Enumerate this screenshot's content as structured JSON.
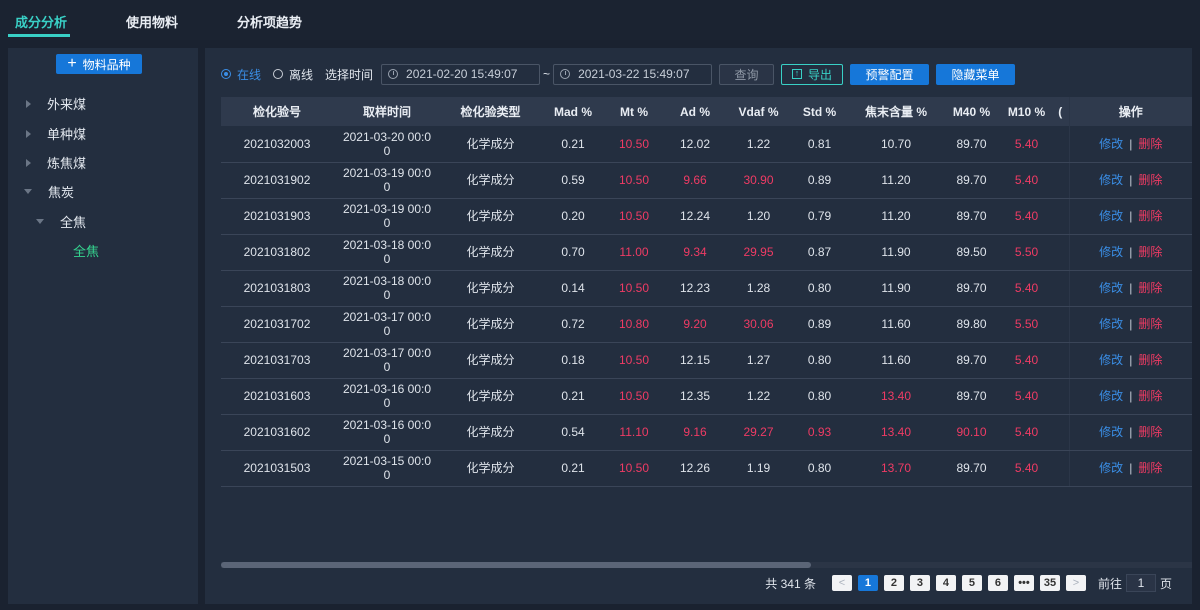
{
  "tabs": [
    {
      "label": "成分分析",
      "active": true
    },
    {
      "label": "使用物料",
      "active": false
    },
    {
      "label": "分析项趋势",
      "active": false
    }
  ],
  "sidebar": {
    "add_button": "物料品种",
    "tree": [
      {
        "label": "外来煤",
        "expanded": false
      },
      {
        "label": "单种煤",
        "expanded": false
      },
      {
        "label": "炼焦煤",
        "expanded": false
      },
      {
        "label": "焦炭",
        "expanded": true
      },
      {
        "label": "全焦",
        "expanded": true
      },
      {
        "label": "全焦",
        "selected": true
      }
    ]
  },
  "filters": {
    "online": "在线",
    "offline": "离线",
    "time_label": "选择时间",
    "start": "2021-02-20 15:49:07",
    "tilde": "~",
    "end": "2021-03-22 15:49:07",
    "query": "查询",
    "export": "导出",
    "warning_config": "预警配置",
    "hide_menu": "隐藏菜单"
  },
  "table": {
    "headers": [
      "检化验号",
      "取样时间",
      "检化验类型",
      "Mad %",
      "Mt %",
      "Ad %",
      "Vdaf %",
      "Std %",
      "焦末含量 %",
      "M40 %",
      "M10 %",
      "(",
      "操作"
    ],
    "edit": "修改",
    "sep": "|",
    "delete": "删除",
    "rows": [
      {
        "id": "2021032003",
        "time1": "2021-03-20 00:0",
        "time2": "0",
        "type": "化学成分",
        "mad": "0.21",
        "mt": "10.50",
        "ad": "12.02",
        "vdaf": "1.22",
        "std": "0.81",
        "jm": "10.70",
        "m40": "89.70",
        "m10": "5.40",
        "red": [
          "mt",
          "m10"
        ]
      },
      {
        "id": "2021031902",
        "time1": "2021-03-19 00:0",
        "time2": "0",
        "type": "化学成分",
        "mad": "0.59",
        "mt": "10.50",
        "ad": "9.66",
        "vdaf": "30.90",
        "std": "0.89",
        "jm": "11.20",
        "m40": "89.70",
        "m10": "5.40",
        "red": [
          "mt",
          "ad",
          "vdaf",
          "m10"
        ]
      },
      {
        "id": "2021031903",
        "time1": "2021-03-19 00:0",
        "time2": "0",
        "type": "化学成分",
        "mad": "0.20",
        "mt": "10.50",
        "ad": "12.24",
        "vdaf": "1.20",
        "std": "0.79",
        "jm": "11.20",
        "m40": "89.70",
        "m10": "5.40",
        "red": [
          "mt",
          "m10"
        ]
      },
      {
        "id": "2021031802",
        "time1": "2021-03-18 00:0",
        "time2": "0",
        "type": "化学成分",
        "mad": "0.70",
        "mt": "11.00",
        "ad": "9.34",
        "vdaf": "29.95",
        "std": "0.87",
        "jm": "11.90",
        "m40": "89.50",
        "m10": "5.50",
        "red": [
          "mt",
          "ad",
          "vdaf",
          "m10"
        ]
      },
      {
        "id": "2021031803",
        "time1": "2021-03-18 00:0",
        "time2": "0",
        "type": "化学成分",
        "mad": "0.14",
        "mt": "10.50",
        "ad": "12.23",
        "vdaf": "1.28",
        "std": "0.80",
        "jm": "11.90",
        "m40": "89.70",
        "m10": "5.40",
        "red": [
          "mt",
          "m10"
        ]
      },
      {
        "id": "2021031702",
        "time1": "2021-03-17 00:0",
        "time2": "0",
        "type": "化学成分",
        "mad": "0.72",
        "mt": "10.80",
        "ad": "9.20",
        "vdaf": "30.06",
        "std": "0.89",
        "jm": "11.60",
        "m40": "89.80",
        "m10": "5.50",
        "red": [
          "mt",
          "ad",
          "vdaf",
          "m10"
        ]
      },
      {
        "id": "2021031703",
        "time1": "2021-03-17 00:0",
        "time2": "0",
        "type": "化学成分",
        "mad": "0.18",
        "mt": "10.50",
        "ad": "12.15",
        "vdaf": "1.27",
        "std": "0.80",
        "jm": "11.60",
        "m40": "89.70",
        "m10": "5.40",
        "red": [
          "mt",
          "m10"
        ]
      },
      {
        "id": "2021031603",
        "time1": "2021-03-16 00:0",
        "time2": "0",
        "type": "化学成分",
        "mad": "0.21",
        "mt": "10.50",
        "ad": "12.35",
        "vdaf": "1.22",
        "std": "0.80",
        "jm": "13.40",
        "m40": "89.70",
        "m10": "5.40",
        "red": [
          "mt",
          "jm",
          "m10"
        ]
      },
      {
        "id": "2021031602",
        "time1": "2021-03-16 00:0",
        "time2": "0",
        "type": "化学成分",
        "mad": "0.54",
        "mt": "11.10",
        "ad": "9.16",
        "vdaf": "29.27",
        "std": "0.93",
        "jm": "13.40",
        "m40": "90.10",
        "m10": "5.40",
        "red": [
          "mt",
          "ad",
          "vdaf",
          "std",
          "jm",
          "m40",
          "m10"
        ]
      },
      {
        "id": "2021031503",
        "time1": "2021-03-15 00:0",
        "time2": "0",
        "type": "化学成分",
        "mad": "0.21",
        "mt": "10.50",
        "ad": "12.26",
        "vdaf": "1.19",
        "std": "0.80",
        "jm": "13.70",
        "m40": "89.70",
        "m10": "5.40",
        "red": [
          "mt",
          "jm",
          "m10"
        ]
      }
    ]
  },
  "pagination": {
    "total": "共 341 条",
    "prev": "<",
    "pages": [
      "1",
      "2",
      "3",
      "4",
      "5",
      "6",
      "•••",
      "35"
    ],
    "current": "1",
    "next": ">",
    "goto_label": "前往",
    "goto_value": "1",
    "page_suffix": "页"
  },
  "colors": {
    "accent": "#39d0c6",
    "primary": "#1677d9",
    "link": "#3a8ee6",
    "danger": "#ef3b64",
    "tree_selected": "#35d48f"
  }
}
